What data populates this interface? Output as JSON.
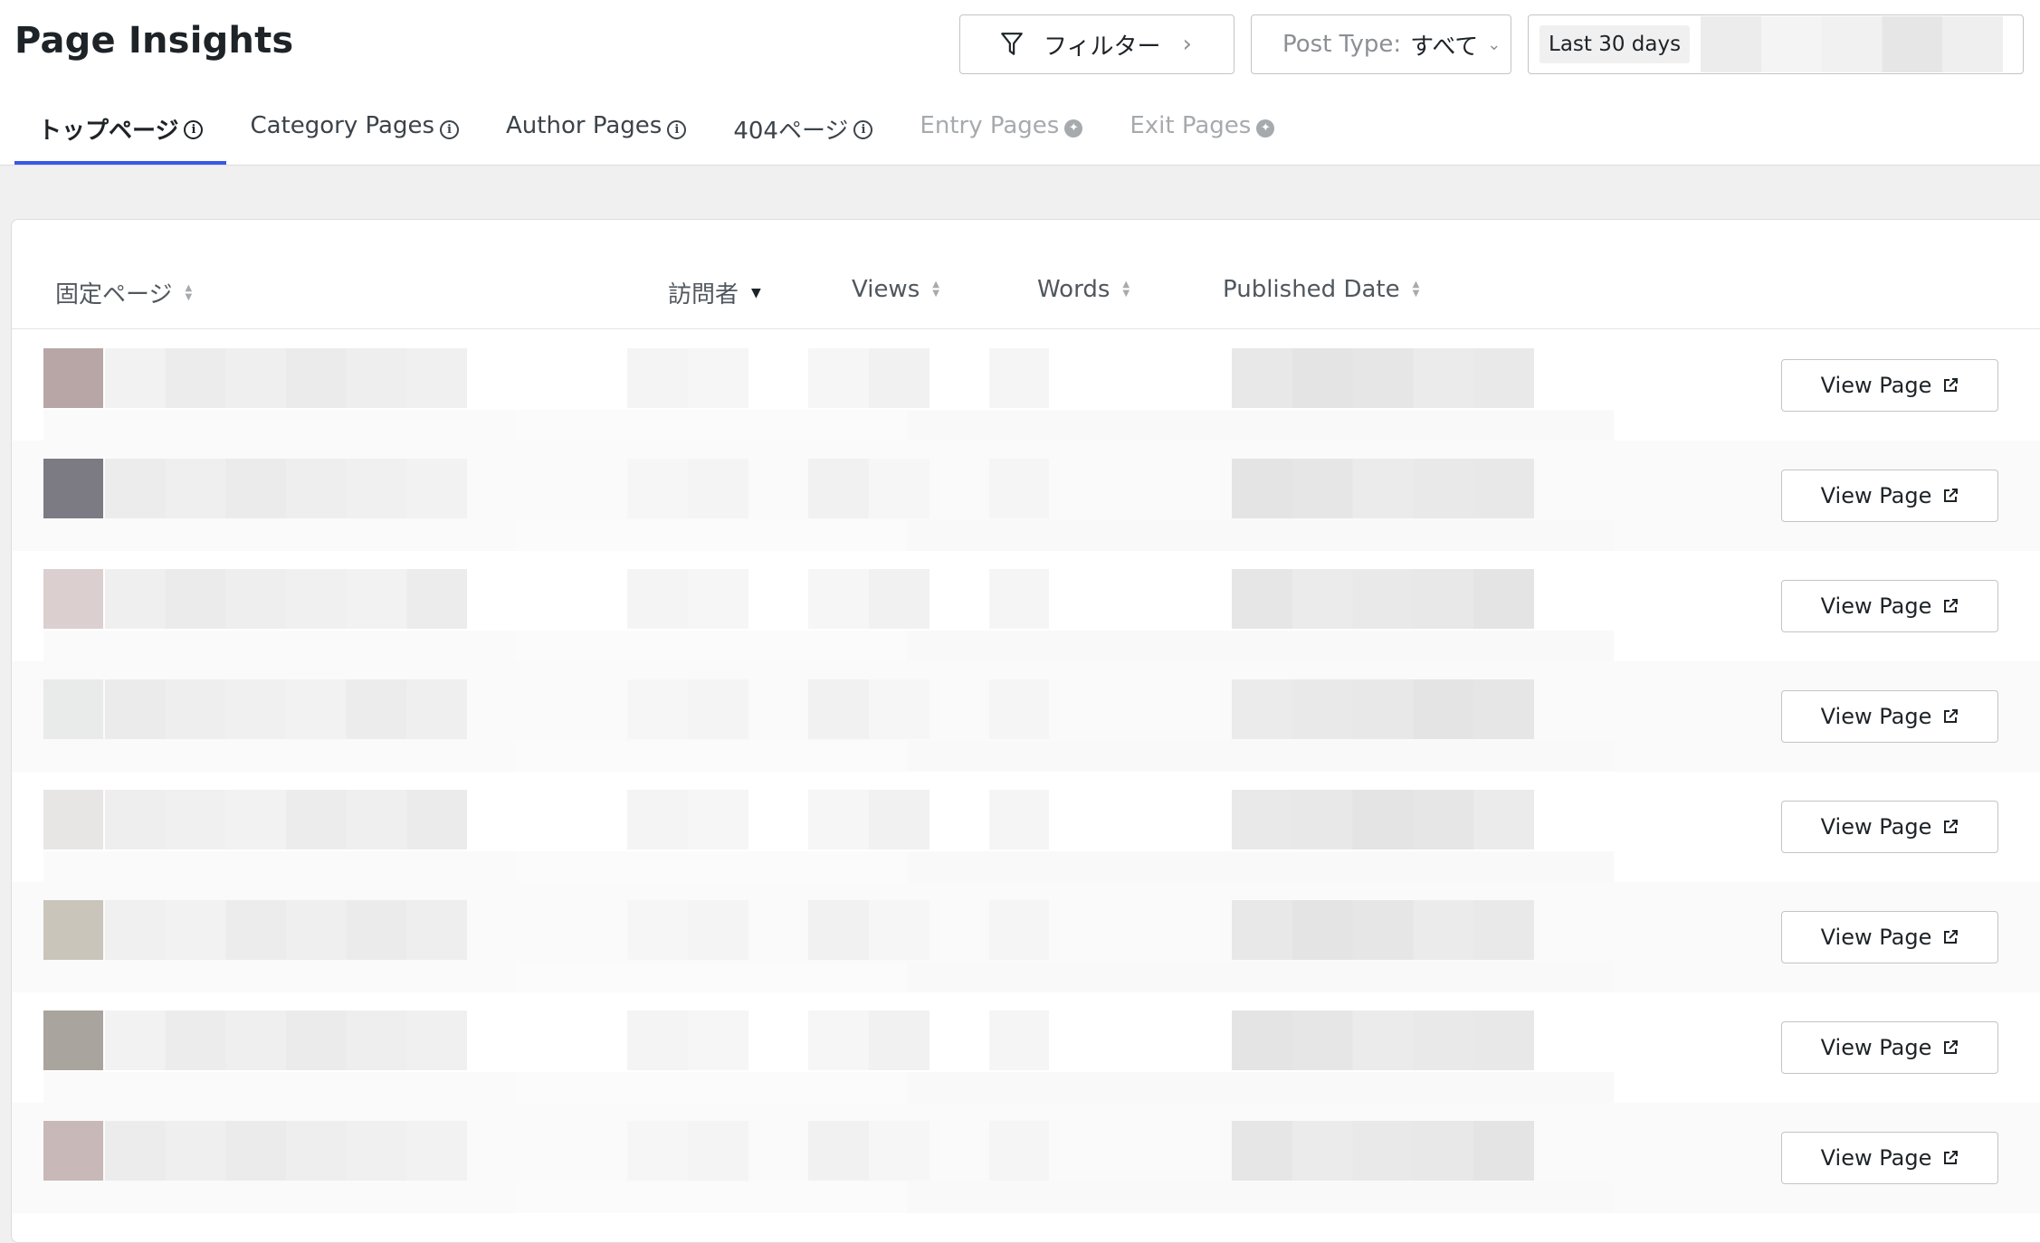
{
  "header": {
    "title": "Page Insights",
    "filter_label": "フィルター",
    "post_type_label": "Post Type:",
    "post_type_value": "すべて",
    "date_range_label": "Last 30 days"
  },
  "tabs": [
    {
      "label": "トップページ",
      "state": "active"
    },
    {
      "label": "Category Pages",
      "state": "normal"
    },
    {
      "label": "Author Pages",
      "state": "normal"
    },
    {
      "label": "404ページ",
      "state": "normal"
    },
    {
      "label": "Entry Pages",
      "state": "locked"
    },
    {
      "label": "Exit Pages",
      "state": "locked"
    }
  ],
  "table": {
    "columns": [
      "固定ページ",
      "訪問者",
      "Views",
      "Words",
      "Published Date"
    ],
    "sorted_column": "訪問者",
    "row_action_label": "View Page",
    "row_count": 8,
    "thumb_colors": [
      "#b8a6a6",
      "#7c7b84",
      "#dccfcf",
      "#e9ebea",
      "#e8e6e4",
      "#c9c5ba",
      "#a9a49d",
      "#c8b8b8"
    ]
  },
  "colors": {
    "accent": "#3858e9",
    "background": "#f0f0f1"
  }
}
